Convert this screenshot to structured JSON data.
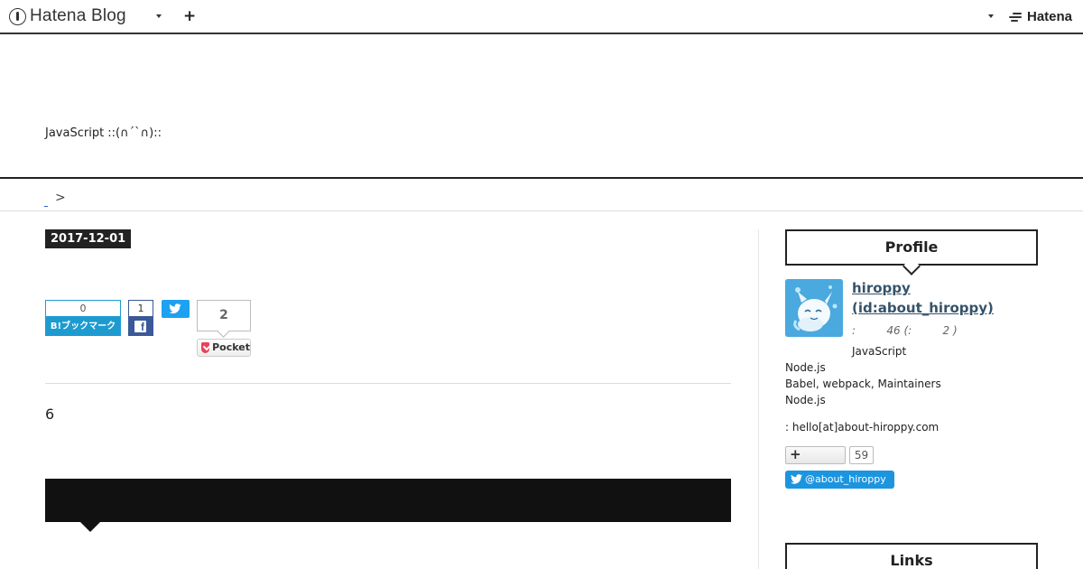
{
  "topbar": {
    "logo_text": "Hatena Blog",
    "plus_label": "+",
    "brand_text": "Hatena"
  },
  "header": {
    "description": "JavaScript ::(∩´`∩)::"
  },
  "breadcrumb": {
    "separator": ">"
  },
  "entry": {
    "date": "2017-12-01",
    "body_text": "6"
  },
  "share": {
    "hatena_bookmark_count": "0",
    "hatena_bookmark_label": "B!ブックマーク",
    "facebook_count": "1",
    "pocket_count": "2",
    "pocket_label": "Pocket"
  },
  "sidebar": {
    "profile_title": "Profile",
    "profile_name_line1": "hiroppy",
    "profile_name_line2": "(id:about_hiroppy)",
    "profile_stats": ":         46 (:         2 )",
    "profile_lines": [
      "JavaScript",
      "Node.js",
      "Babel, webpack, Maintainers",
      "Node.js"
    ],
    "contact": ": hello[at]about-hiroppy.com",
    "follow_label": "+",
    "follow_count": "59",
    "twitter_follow_label": "@about_hiroppy",
    "links_title": "Links"
  },
  "colors": {
    "accent_blue": "#1d9bd1",
    "facebook": "#3b5998",
    "twitter": "#1da1f2",
    "pocket": "#ee4056",
    "dark": "#111111"
  }
}
